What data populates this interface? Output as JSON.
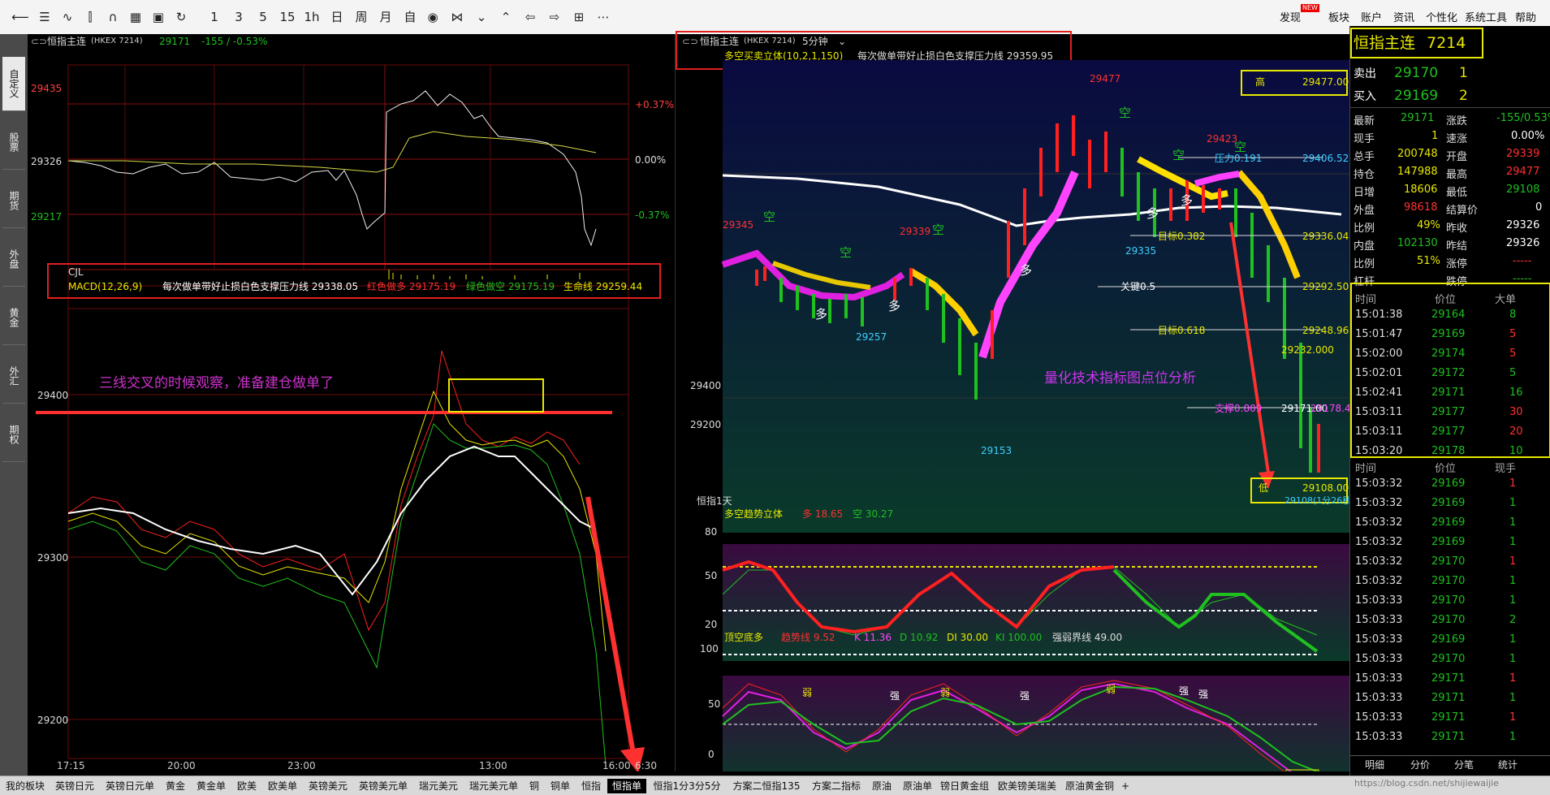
{
  "toolbar": {
    "icons": [
      "back-arrow-icon",
      "list-icon",
      "line-chart-icon",
      "candlestick-icon",
      "magnet-icon",
      "table-icon",
      "save-icon",
      "refresh-icon"
    ],
    "periods": [
      "1",
      "3",
      "5",
      "15",
      "1h",
      "日",
      "周",
      "月",
      "自"
    ],
    "menu": [
      "发现",
      "板块",
      "账户",
      "资讯",
      "个性化",
      "系统工具",
      "帮助"
    ],
    "new_badge": "NEW"
  },
  "sidebar": {
    "tabs": [
      "自定义",
      "股票",
      "期货",
      "外盘",
      "黄金",
      "外汇",
      "期权"
    ]
  },
  "left_chart": {
    "header_icon": "chart-toggle-icon",
    "title": "恒指主连",
    "code": "(HKEX 7214)",
    "price": "29171",
    "change": "-155 / -0.53%",
    "y_labels_top": [
      "29435",
      "29326",
      "29217"
    ],
    "pct_labels": [
      "+0.37%",
      "0.00%",
      "-0.37%"
    ],
    "cjl": "CJL",
    "macd_label": "MACD(12,26,9)",
    "indicator_text": "每次做单带好止损白色支撑压力线 29338.05",
    "red_label": "红色做多 29175.19",
    "green_label": "绿色做空 29175.19",
    "life_label": "生命线 29259.44",
    "annotation": "三线交叉的时候观察，准备建仓做单了",
    "y_labels_bottom": [
      "29400",
      "29300",
      "29200"
    ],
    "x_labels": [
      "17:15",
      "20:00",
      "23:00",
      "13:00",
      "16:00",
      "6:30"
    ]
  },
  "right_chart": {
    "title": "恒指主连",
    "code": "(HKEX 7214)",
    "period": "5分钟",
    "indicator_name": "多空买卖立体(10,2,1,150)",
    "indicator_text": "每次做单带好止损白色支撑压力线 29359.95",
    "y_labels": [
      "29400",
      "29200"
    ],
    "price_marks": [
      "29477",
      "29345",
      "29339",
      "29423",
      "29335",
      "29257",
      "29153",
      "29108"
    ],
    "high_label": "高",
    "high_value": "29477.00",
    "low_label": "低",
    "low_value": "29108.00",
    "pressure": "压力0.191",
    "pressure_val": "29406.52",
    "target1": "目标0.382",
    "target1_val": "29336.04",
    "key": "关键0.5",
    "key_val": "29292.50",
    "target2": "目标0.618",
    "target2_val": "29248.96",
    "target2_sub": "29232.000",
    "support": "支撑0.809",
    "support_val": "29171.00",
    "support_val2": "29178.48",
    "countdown": "29108(1分26秒)",
    "kong": "空",
    "duo": "多",
    "annotation": "量化技术指标图点位分析",
    "sub1_name": "多空趋势立体",
    "sub1_duo": "多 18.65",
    "sub1_kong": "空 30.27",
    "sub1_y": [
      "80",
      "50",
      "20"
    ],
    "sub2_name": "顶空底多",
    "sub2_vals": [
      "趋势线 9.52",
      "K 11.36",
      "D 10.92",
      "DI 30.00",
      "KI 100.00",
      "强弱界线 49.00"
    ],
    "sub2_y": [
      "100",
      "50",
      "0"
    ],
    "qiang": "强",
    "ruo": "弱",
    "period_mark": "恒指1天"
  },
  "quote": {
    "title": "恒指主连",
    "code": "7214",
    "sell_label": "卖出",
    "sell_price": "29170",
    "sell_vol": "1",
    "buy_label": "买入",
    "buy_price": "29169",
    "buy_vol": "2",
    "stats": [
      [
        "最新",
        "29171",
        "涨跌",
        "-155/0.53%"
      ],
      [
        "现手",
        "1",
        "速涨",
        "0.00%"
      ],
      [
        "总手",
        "200748",
        "开盘",
        "29339"
      ],
      [
        "持仓",
        "147988",
        "最高",
        "29477"
      ],
      [
        "日增",
        "18606",
        "最低",
        "29108"
      ],
      [
        "外盘",
        "98618",
        "结算价",
        "0"
      ],
      [
        "比例",
        "49%",
        "昨收",
        "29326"
      ],
      [
        "内盘",
        "102130",
        "昨结",
        "29326"
      ],
      [
        "比例",
        "51%",
        "涨停",
        "-----"
      ],
      [
        "杠杆",
        "",
        "跌停",
        "-----"
      ]
    ],
    "big_header": [
      "时间",
      "价位",
      "大单"
    ],
    "big_orders": [
      [
        "15:01:38",
        "29164",
        "8"
      ],
      [
        "15:01:47",
        "29169",
        "5"
      ],
      [
        "15:02:00",
        "29174",
        "5"
      ],
      [
        "15:02:01",
        "29172",
        "5"
      ],
      [
        "15:02:41",
        "29171",
        "16"
      ],
      [
        "15:03:11",
        "29177",
        "30"
      ],
      [
        "15:03:11",
        "29177",
        "20"
      ],
      [
        "15:03:20",
        "29178",
        "10"
      ]
    ],
    "tick_header": [
      "时间",
      "价位",
      "现手"
    ],
    "ticks": [
      [
        "15:03:32",
        "29169",
        "1"
      ],
      [
        "15:03:32",
        "29169",
        "1"
      ],
      [
        "15:03:32",
        "29169",
        "1"
      ],
      [
        "15:03:32",
        "29169",
        "1"
      ],
      [
        "15:03:32",
        "29170",
        "1"
      ],
      [
        "15:03:32",
        "29170",
        "1"
      ],
      [
        "15:03:33",
        "29170",
        "1"
      ],
      [
        "15:03:33",
        "29170",
        "2"
      ],
      [
        "15:03:33",
        "29169",
        "1"
      ],
      [
        "15:03:33",
        "29170",
        "1"
      ],
      [
        "15:03:33",
        "29171",
        "1"
      ],
      [
        "15:03:33",
        "29171",
        "1"
      ],
      [
        "15:03:33",
        "29171",
        "1"
      ],
      [
        "15:03:33",
        "29171",
        "1"
      ]
    ],
    "bottom_tabs": [
      "明细",
      "分价",
      "分笔",
      "统计"
    ]
  },
  "bottom_tabs": [
    "我的板块",
    "英镑日元",
    "英镑日元单",
    "黄金",
    "黄金单",
    "欧美",
    "欧美单",
    "英镑美元",
    "英镑美元单",
    "瑞元美元",
    "瑞元美元单",
    "铜",
    "铜单",
    "恒指",
    "恒指单",
    "恒指1分3分5分",
    "方案二恒指135",
    "方案二指标",
    "原油",
    "原油单",
    "镑日黄金组",
    "欧美镑美瑞美",
    "原油黄金铜",
    "+"
  ],
  "watermark": "https://blog.csdn.net/shijiewaijie",
  "colors": {
    "up": "#ff2020",
    "down": "#1fc01f",
    "white_line": "#ffffff",
    "yellow": "#e8e800",
    "grid_red": "#8a1010"
  }
}
